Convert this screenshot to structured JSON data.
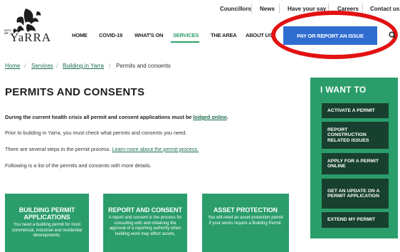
{
  "utility_nav": [
    "Councillors",
    "News",
    "Have your say",
    "Careers",
    "Contact us"
  ],
  "logo": {
    "city_of": "CITY OF",
    "wordmark": "YaRRA"
  },
  "main_nav": [
    "HOME",
    "COVID-19",
    "WHAT'S ON",
    "SERVICES",
    "THE AREA",
    "ABOUT US"
  ],
  "active_nav": "SERVICES",
  "cta_label": "PAY OR REPORT AN ISSUE",
  "breadcrumb": [
    "Home",
    "Services",
    "Building in Yarra",
    "Permits and consents"
  ],
  "page_title": "PERMITS AND CONSENTS",
  "intro": {
    "notice_prefix": "During the current health crisis all permit and consent applications must be ",
    "notice_link": "lodged online",
    "notice_suffix": ".",
    "p1": "Prior to building in Yarra, you must check what permits and consents you need.",
    "p2_prefix": "There are several steps in the permit process. ",
    "p2_link": "Learn more about the permit process.",
    "p3": "Following is a list of the permits and consents with more details."
  },
  "side_panel": {
    "title": "I WANT TO",
    "buttons": [
      "ACTIVATE A PERMIT",
      "REPORT CONSTRUCTION RELATED ISSUES",
      "APPLY FOR A PERMIT ONLINE",
      "GET AN UPDATE ON A PERMIT APPLICATION",
      "EXTEND MY PERMIT"
    ]
  },
  "cards": [
    {
      "title": "BUILDING PERMIT APPLICATIONS",
      "text": "You need a building permit for most commercial, industrial and residential developments."
    },
    {
      "title": "REPORT AND CONSENT",
      "text": "A report and consent is the process for consulting with and obtaining the approval of a reporting authority when building work may affect assets,"
    },
    {
      "title": "ASSET PROTECTION",
      "text": "You will need an asset protection permit if your works require a Building Permit."
    }
  ],
  "colors": {
    "green": "#2a9d6a",
    "dark_green": "#17402e",
    "cta_blue": "#2f6dd1",
    "ring_red": "#e31212",
    "link_green": "#1a6e4a"
  }
}
